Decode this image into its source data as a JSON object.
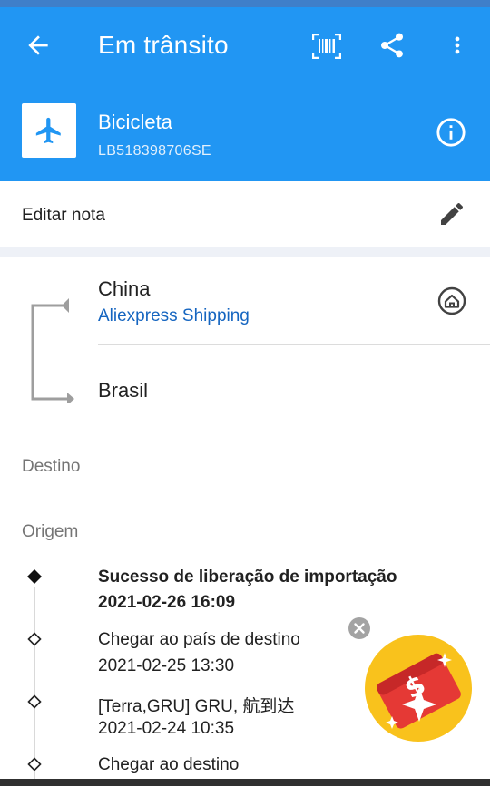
{
  "appbar": {
    "title": "Em trânsito",
    "icons": [
      "back-arrow-icon",
      "barcode-icon",
      "share-icon",
      "more-vert-icon"
    ]
  },
  "package": {
    "name": "Bicicleta",
    "code": "LB518398706SE",
    "icon": "airplane-icon"
  },
  "note": {
    "label": "Editar nota"
  },
  "route": {
    "origin": "China",
    "carrier": "Aliexpress Shipping",
    "destination": "Brasil"
  },
  "sections": {
    "destino": "Destino",
    "origem": "Origem"
  },
  "events": [
    {
      "title": "Sucesso de liberação de importação",
      "datetime": "2021-02-26 16:09",
      "current": true
    },
    {
      "title": "Chegar ao país de destino",
      "datetime": "2021-02-25 13:30",
      "current": false
    },
    {
      "title": "[Terra,GRU] GRU, 航到达",
      "datetime": "2021-02-24 10:35",
      "current": false
    },
    {
      "title": "Chegar ao destino",
      "datetime": "",
      "current": false
    }
  ],
  "colors": {
    "primary": "#2196f3",
    "link": "#1565c0",
    "promo_yellow": "#f9c21c",
    "promo_red": "#e53935"
  }
}
